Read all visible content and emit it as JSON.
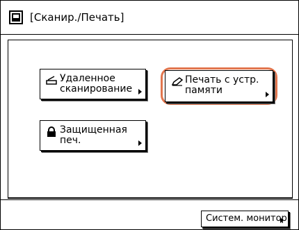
{
  "header": {
    "title": "[Сканир./Печать]",
    "icon": "scan-print-icon"
  },
  "buttons": {
    "remote_scan": {
      "label": "Удаленное\nсканирование",
      "icon": "scanner-icon"
    },
    "memory_print": {
      "label": "Печать с устр.\nпамяти",
      "icon": "pencil-icon",
      "highlight_color": "#e2764e"
    },
    "secure_print": {
      "label": "Защищенная\nпеч.",
      "icon": "lock-icon"
    }
  },
  "footer": {
    "monitor_label": "Систем. монитор"
  }
}
